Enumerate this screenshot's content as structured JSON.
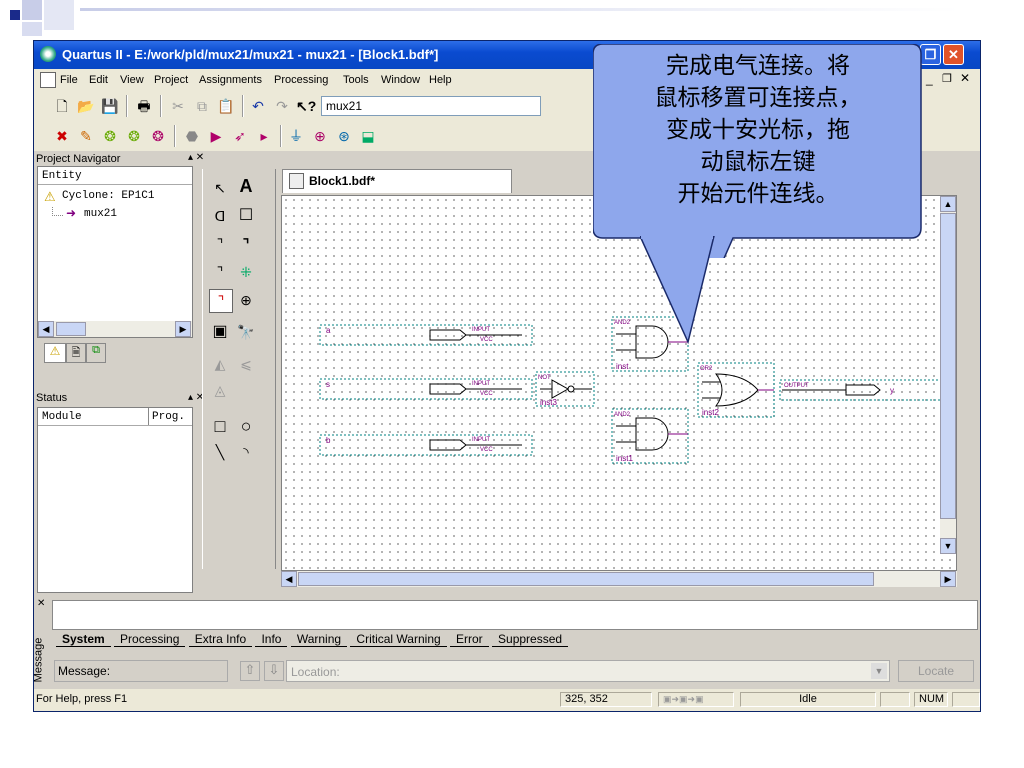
{
  "window": {
    "title": "Quartus II - E:/work/pld/mux21/mux21 - mux21 - [Block1.bdf*]"
  },
  "menu": [
    "File",
    "Edit",
    "View",
    "Project",
    "Assignments",
    "Processing",
    "Tools",
    "Window",
    "Help"
  ],
  "toolbar": {
    "project_combo": "mux21"
  },
  "project_navigator": {
    "title": "Project Navigator",
    "header": "Entity",
    "device": "Cyclone: EP1C1",
    "entity": "mux21"
  },
  "status_panel": {
    "title": "Status",
    "col_module": "Module",
    "col_prog": "Prog."
  },
  "document": {
    "tab": "Block1.bdf*"
  },
  "schematic": {
    "inputs": [
      {
        "name": "a",
        "label": "INPUT",
        "vcc": "VCC"
      },
      {
        "name": "s",
        "label": "INPUT",
        "vcc": "VCC"
      },
      {
        "name": "b",
        "label": "INPUT",
        "vcc": "VCC"
      }
    ],
    "gates": [
      {
        "type": "AND2",
        "inst": "inst"
      },
      {
        "type": "NOT",
        "inst": "inst3"
      },
      {
        "type": "AND2",
        "inst": "inst1"
      },
      {
        "type": "OR2",
        "inst": "inst2"
      }
    ],
    "output": {
      "label": "OUTPUT",
      "name": "y"
    }
  },
  "messages": {
    "tabs": [
      "System",
      "Processing",
      "Extra Info",
      "Info",
      "Warning",
      "Critical Warning",
      "Error",
      "Suppressed"
    ],
    "side_label": "Message",
    "message_label": "Message:",
    "location_placeholder": "Location:",
    "locate_button": "Locate"
  },
  "statusbar": {
    "help": "For Help, press F1",
    "coords": "325, 352",
    "state": "Idle",
    "num": "NUM"
  },
  "callout": {
    "lines": [
      "完成电气连接。将",
      "鼠标移置可连接点，",
      "变成十安光标，拖",
      "动鼠标左键",
      "开始元件连线。"
    ]
  },
  "colors": {
    "titlebar": "#0a4bd0",
    "callout_fill": "#8ea7ec",
    "wire": "#800080",
    "selection": "#008080"
  }
}
